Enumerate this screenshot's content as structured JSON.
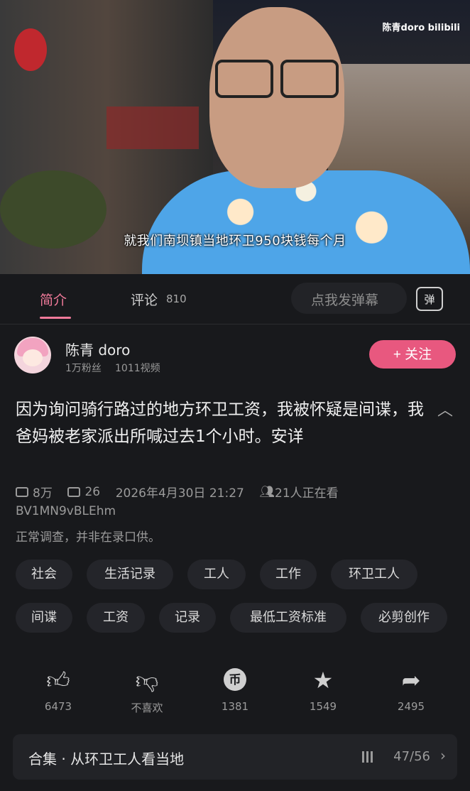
{
  "video": {
    "subtitle": "就我们南坝镇当地环卫950块钱每个月",
    "watermark": "陈青doro bilibili"
  },
  "tabs": {
    "intro": "简介",
    "comment": "评论",
    "comment_count": "810",
    "danmaku_placeholder": "点我发弹幕",
    "danmaku_toggle": "弹"
  },
  "uploader": {
    "name": "陈青 doro",
    "fans": "1万粉丝",
    "videos": "1011视频",
    "follow_label": "+ 关注"
  },
  "video_info": {
    "title": "因为询问骑行路过的地方环卫工资，我被怀疑是间谍，我爸妈被老家派出所喊过去1个小时。安详",
    "plays": "8万",
    "danmaku_count": "26",
    "date": "2026年4月30日 21:27",
    "watching": "21人正在看",
    "bvid": "BV1MN9vBLEhm",
    "description": "正常调查，并非在录口供。"
  },
  "tags": [
    "社会",
    "生活记录",
    "工人",
    "工作",
    "环卫工人",
    "间谍",
    "工资",
    "记录",
    "最低工资标准",
    "必剪创作"
  ],
  "actions": {
    "like": "6473",
    "dislike": "不喜欢",
    "coin": "1381",
    "favorite": "1549",
    "share": "2495"
  },
  "collection": {
    "title": "合集 · 从环卫工人看当地",
    "progress": "47/56"
  },
  "colors": {
    "accent": "#e8587f",
    "tab_active": "#f07a9a",
    "background": "#18191c"
  }
}
